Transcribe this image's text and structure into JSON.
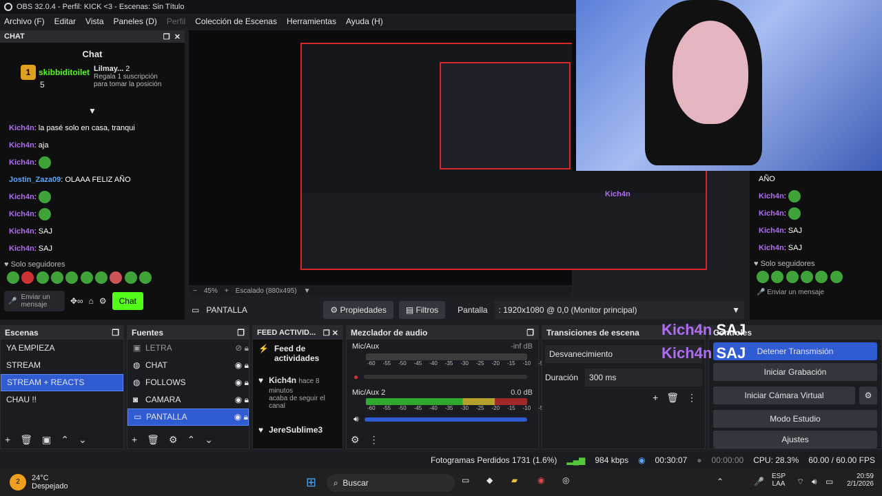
{
  "window": {
    "title": "OBS 32.0.4 - Perfil: KICK <3 - Escenas: Sin Título"
  },
  "menu": [
    "Archivo (F)",
    "Editar",
    "Vista",
    "Paneles (D)",
    "Perfil",
    "Colección de Escenas",
    "Herramientas",
    "Ayuda (H)"
  ],
  "chat": {
    "dock_title": "CHAT",
    "title": "Chat",
    "top_user": "skibbiditoilet",
    "top_count": "5",
    "gift_user": "Lilmay...",
    "gift_count": "2",
    "gift_text": "Regala 1 suscripción para tomar la posición",
    "messages": [
      {
        "user": "Kich4n",
        "text": ": la pasé solo en casa, tranqui"
      },
      {
        "user": "Kich4n",
        "text": ": aja"
      },
      {
        "user": "Kich4n",
        "text": ":"
      },
      {
        "user": "Jostin_Zaza09",
        "text": ": OLAAA FELIZ AÑO"
      },
      {
        "user": "Kich4n",
        "text": ":"
      },
      {
        "user": "Kich4n",
        "text": ":"
      },
      {
        "user": "Kich4n",
        "text": ": SAJ"
      },
      {
        "user": "Kich4n",
        "text": ": SAJ"
      }
    ],
    "followers_only": "Solo seguidores",
    "input_placeholder": "Enviar un mensaje",
    "send_label": "Chat"
  },
  "rchat": {
    "first": "AÑO",
    "messages": [
      {
        "user": "Kich4n",
        "text": ":"
      },
      {
        "user": "Kich4n",
        "text": ":"
      },
      {
        "user": "Kich4n",
        "text": ": SAJ"
      },
      {
        "user": "Kich4n",
        "text": ": SAJ"
      }
    ],
    "followers_only": "Solo seguidores",
    "input_placeholder": "Enviar un mensaje"
  },
  "preview": {
    "zoom": "45%",
    "scaling": "Escalado (880x495)"
  },
  "props": {
    "source": "PANTALLA",
    "properties": "Propiedades",
    "filters": "Filtros",
    "screen_label": "Pantalla",
    "screen_value": ": 1920x1080 @ 0,0 (Monitor principal)"
  },
  "scenes": {
    "title": "Escenas",
    "items": [
      "YA EMPIEZA",
      "STREAM",
      "STREAM + REACTS",
      "CHAU !!"
    ],
    "selected": 2
  },
  "sources": {
    "title": "Fuentes",
    "items": [
      "LETRA",
      "CHAT",
      "FOLLOWS",
      "CAMARA",
      "PANTALLA"
    ],
    "selected": 4
  },
  "feed": {
    "title": "FEED ACTIVID...",
    "header": "Feed de actividades",
    "entries": [
      {
        "user": "Kich4n",
        "time": "hace 8 minutos",
        "text": "acaba de seguir el canal"
      },
      {
        "user": "JereSublime3",
        "time": "",
        "text": ""
      }
    ]
  },
  "mixer": {
    "title": "Mezclador de audio",
    "channels": [
      {
        "name": "Mic/Aux",
        "db": "-inf dB",
        "level": 0.0
      },
      {
        "name": "Mic/Aux 2",
        "db": "0.0 dB",
        "level": 0.9
      }
    ],
    "ticks": [
      "-60",
      "-55",
      "-50",
      "-45",
      "-40",
      "-35",
      "-30",
      "-25",
      "-20",
      "-15",
      "-10",
      "-5",
      "0"
    ]
  },
  "transitions": {
    "title": "Transiciones de escena",
    "type": "Desvanecimiento",
    "duration_label": "Duración",
    "duration": "300 ms"
  },
  "controls": {
    "title": "Controles",
    "buttons": [
      "Detener Transmisión",
      "Iniciar Grabación",
      "Iniciar Cámara Virtual",
      "Modo Estudio",
      "Ajustes"
    ]
  },
  "overlay": {
    "user": "Kich4n",
    "word": "SAJ"
  },
  "status": {
    "dropped": "Fotogramas Perdidos 1731 (1.6%)",
    "bitrate": "984 kbps",
    "live": "00:30:07",
    "rec": "00:00:00",
    "cpu": "CPU: 28.3%",
    "fps": "60.00 / 60.00 FPS"
  },
  "taskbar": {
    "temp": "24°C",
    "weather": "Despejado",
    "search": "Buscar",
    "lang1": "ESP",
    "lang2": "LAA",
    "time": "20:59",
    "date": "2/1/2026",
    "badge": "2"
  },
  "colors": {
    "accent": "#2f5bd3",
    "kick_green": "#53fc18",
    "username": "#b06cf5"
  }
}
